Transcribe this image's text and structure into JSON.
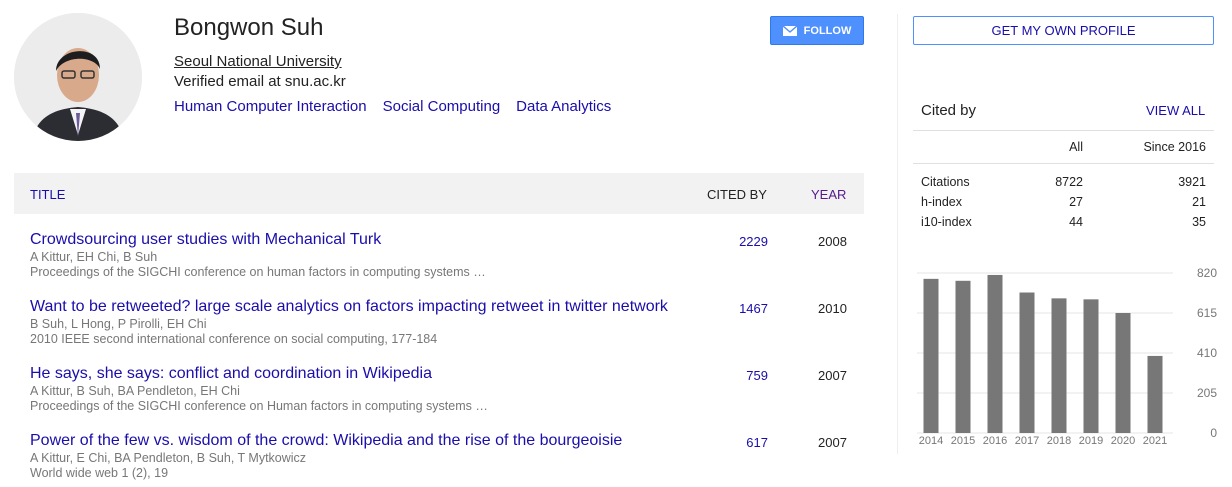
{
  "profile": {
    "name": "Bongwon Suh",
    "affiliation": "Seoul National University",
    "email": "Verified email at snu.ac.kr",
    "interests": [
      "Human Computer Interaction",
      "Social Computing",
      "Data Analytics"
    ],
    "follow_label": "FOLLOW"
  },
  "table": {
    "headers": {
      "title": "TITLE",
      "cited_by": "CITED BY",
      "year": "YEAR"
    },
    "rows": [
      {
        "title": "Crowdsourcing user studies with Mechanical Turk",
        "authors": "A Kittur, EH Chi, B Suh",
        "venue": "Proceedings of the SIGCHI conference on human factors in computing systems …",
        "cited_by": "2229",
        "year": "2008"
      },
      {
        "title": "Want to be retweeted? large scale analytics on factors impacting retweet in twitter network",
        "authors": "B Suh, L Hong, P Pirolli, EH Chi",
        "venue": "2010 IEEE second international conference on social computing, 177-184",
        "cited_by": "1467",
        "year": "2010"
      },
      {
        "title": "He says, she says: conflict and coordination in Wikipedia",
        "authors": "A Kittur, B Suh, BA Pendleton, EH Chi",
        "venue": "Proceedings of the SIGCHI conference on Human factors in computing systems …",
        "cited_by": "759",
        "year": "2007"
      },
      {
        "title": "Power of the few vs. wisdom of the crowd: Wikipedia and the rise of the bourgeoisie",
        "authors": "A Kittur, E Chi, BA Pendleton, B Suh, T Mytkowicz",
        "venue": "World wide web 1 (2), 19",
        "cited_by": "617",
        "year": "2007"
      }
    ]
  },
  "sidebar": {
    "get_profile_label": "GET MY OWN PROFILE",
    "cited_by_title": "Cited by",
    "view_all_label": "VIEW ALL",
    "col_all": "All",
    "col_since": "Since 2016",
    "stats": [
      {
        "label": "Citations",
        "all": "8722",
        "since": "3921"
      },
      {
        "label": "h-index",
        "all": "27",
        "since": "21"
      },
      {
        "label": "i10-index",
        "all": "44",
        "since": "35"
      }
    ]
  },
  "colors": {
    "accent": "#4d90fe",
    "link": "#1a0dab",
    "visited": "#551a8b",
    "bar": "#777777"
  },
  "chart_data": {
    "type": "bar",
    "categories": [
      "2014",
      "2015",
      "2016",
      "2017",
      "2018",
      "2019",
      "2020",
      "2021"
    ],
    "values": [
      790,
      780,
      810,
      720,
      690,
      685,
      615,
      395
    ],
    "ylim": [
      0,
      820
    ],
    "yticks": [
      "820",
      "615",
      "410",
      "205",
      "0"
    ],
    "grid": true,
    "ytick_position": "right"
  }
}
